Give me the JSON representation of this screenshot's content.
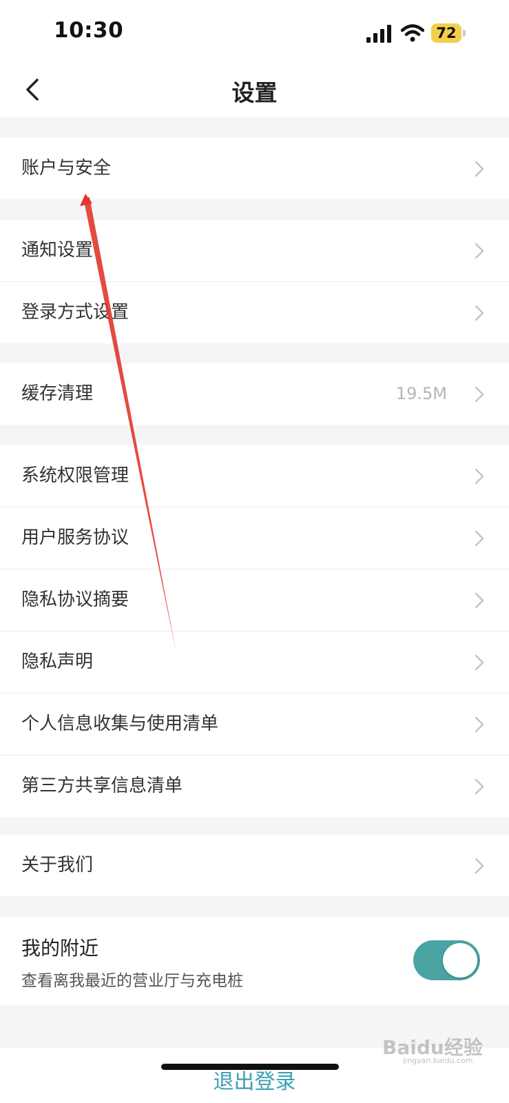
{
  "status_bar": {
    "time": "10:30",
    "battery": "72"
  },
  "nav": {
    "title": "设置"
  },
  "groups": {
    "account": [
      {
        "label": "账户与安全"
      }
    ],
    "login": [
      {
        "label": "通知设置"
      },
      {
        "label": "登录方式设置"
      }
    ],
    "cache": [
      {
        "label": "缓存清理",
        "value": "19.5M"
      }
    ],
    "policies": [
      {
        "label": "系统权限管理"
      },
      {
        "label": "用户服务协议"
      },
      {
        "label": "隐私协议摘要"
      },
      {
        "label": "隐私声明"
      },
      {
        "label": "个人信息收集与使用清单"
      },
      {
        "label": "第三方共享信息清单"
      }
    ],
    "about": [
      {
        "label": "关于我们"
      }
    ]
  },
  "nearby": {
    "title": "我的附近",
    "description": "查看离我最近的营业厅与充电桩",
    "enabled": true
  },
  "logout_label": "退出登录",
  "watermark": {
    "text": "Baidu经验",
    "sub": "jingyan.baidu.com"
  },
  "colors": {
    "accent": "#4aa3a3",
    "annotation_arrow": "#e0372c"
  }
}
